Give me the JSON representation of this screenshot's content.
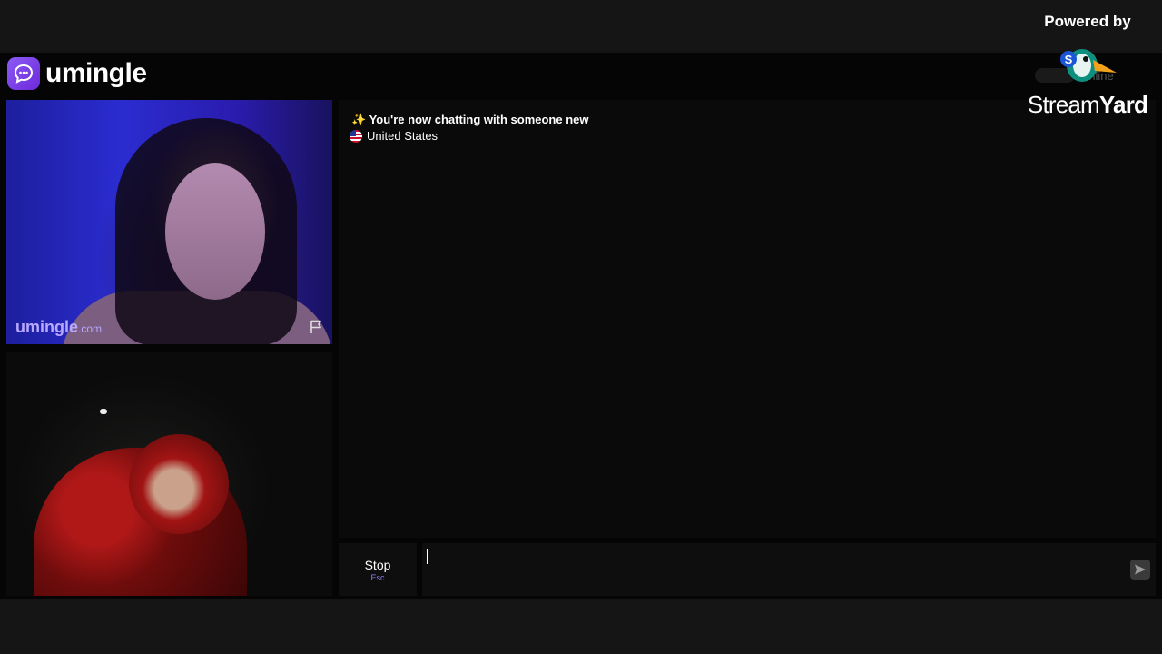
{
  "brand": {
    "name": "umingle",
    "watermark_main": "umingle",
    "watermark_suffix": ".com",
    "accent_color": "#7c4dff"
  },
  "chat": {
    "system_message": "✨ You're now chatting with someone new",
    "country": "United States"
  },
  "controls": {
    "stop_label": "Stop",
    "stop_hint": "Esc",
    "message_value": ""
  },
  "status": {
    "online_text": "online"
  },
  "overlay": {
    "powered_by": "Powered by",
    "stream_label": "Stream",
    "yard_label": "Yard"
  },
  "icons": {
    "logo": "chat-bubble-icon",
    "report": "flag-icon",
    "send": "send-arrow-icon",
    "country_flag": "us-flag-icon"
  }
}
